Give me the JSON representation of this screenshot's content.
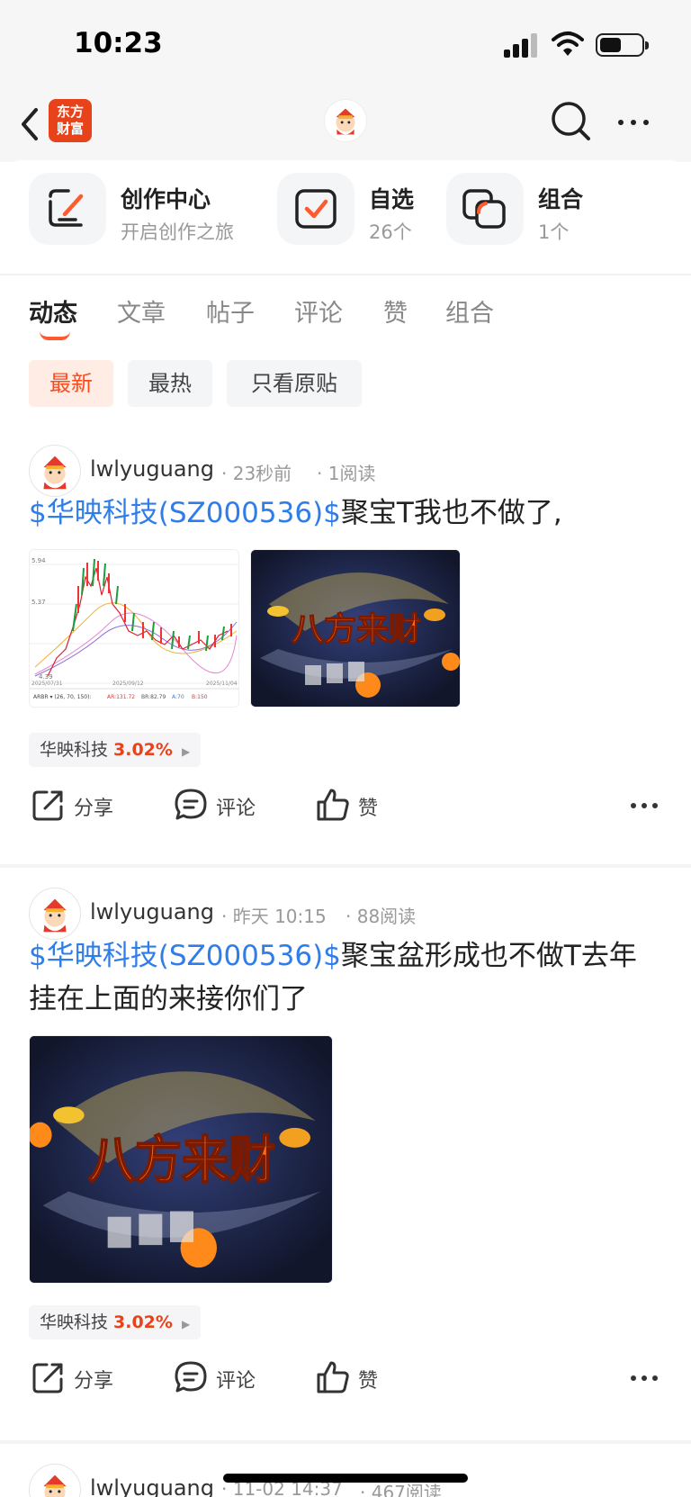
{
  "status": {
    "time": "10:23"
  },
  "topbar": {
    "logo_text_1": "东方",
    "logo_text_2": "财富"
  },
  "quick": [
    {
      "title": "创作中心",
      "sub": "开启创作之旅"
    },
    {
      "title": "自选",
      "sub": "26个"
    },
    {
      "title": "组合",
      "sub": "1个"
    }
  ],
  "tabs": [
    "动态",
    "文章",
    "帖子",
    "评论",
    "赞",
    "组合"
  ],
  "chips": [
    "最新",
    "最热",
    "只看原贴"
  ],
  "posts": [
    {
      "user": "lwlyuguang",
      "time": "23秒前",
      "reads": "1阅读",
      "stock_link": "$华映科技(SZ000536)$",
      "text": "聚宝T我也不做了,",
      "chart_labels": {
        "y1": "5.94",
        "y2": "5.37",
        "y3": "4.39",
        "d1": "2025/07/31",
        "d2": "2025/09/12",
        "d3": "2025/11/04",
        "ind": "ARBR ▾ (26, 70, 150):",
        "ar": "AR:131.72",
        "br": "BR:82.79",
        "a": "A:70",
        "b": "B:150"
      },
      "banner_text": "八方来财",
      "tag_name": "华映科技",
      "tag_pct": "3.02%"
    },
    {
      "user": "lwlyuguang",
      "time": "昨天 10:15",
      "reads": "88阅读",
      "stock_link": "$华映科技(SZ000536)$",
      "text": "聚宝盆形成也不做T去年挂在上面的来接你们了",
      "banner_text": "八方来财",
      "tag_name": "华映科技",
      "tag_pct": "3.02%"
    },
    {
      "user": "lwlyuguang",
      "time": "11-02 14:37",
      "reads": "467阅读"
    }
  ],
  "actions": {
    "share": "分享",
    "comment": "评论",
    "like": "赞"
  },
  "colors": {
    "brand": "#e8421a",
    "link": "#2f7de8",
    "accent": "#ff5a2e"
  }
}
